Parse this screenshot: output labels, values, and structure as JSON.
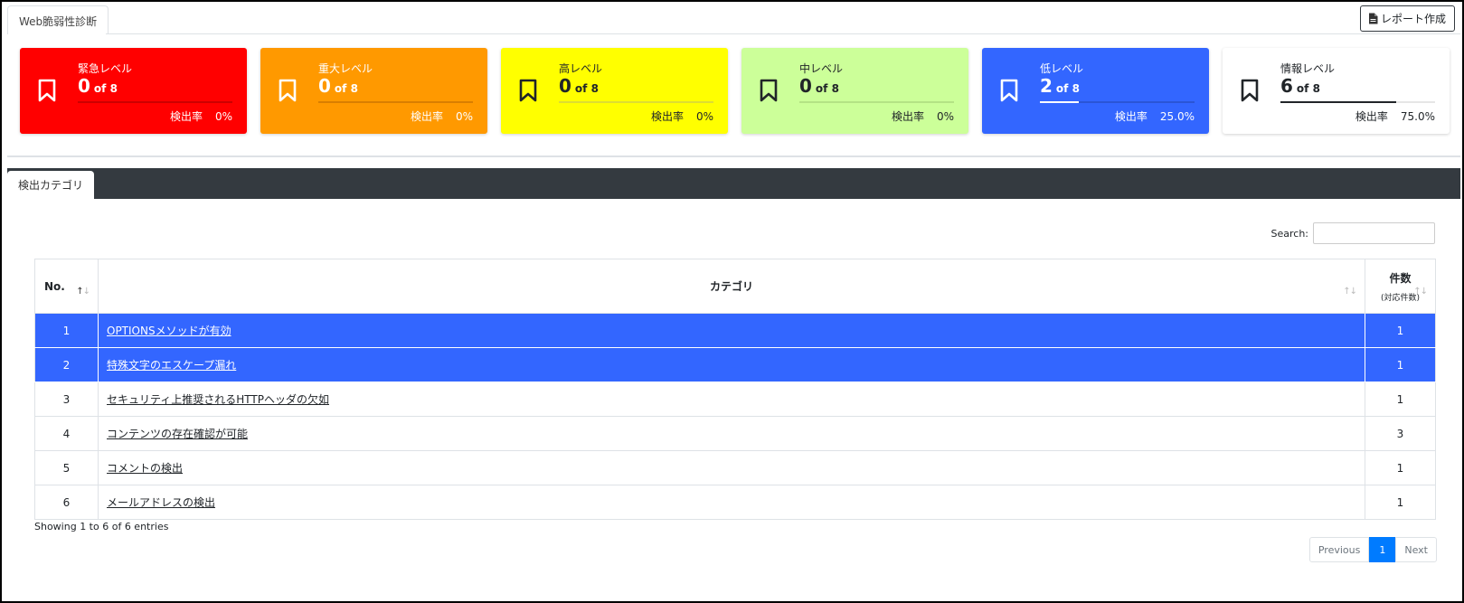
{
  "header": {
    "tab_label": "Web脆弱性診断",
    "report_button": "レポート作成"
  },
  "cards": [
    {
      "title": "緊急レベル",
      "count": "0",
      "of": "of 8",
      "rate_label": "検出率",
      "rate_value": "0%",
      "ratio": 0.0,
      "bg": "#ff0000",
      "fg": "#ffffff",
      "track": "#cc0000",
      "fill": "#ffffff"
    },
    {
      "title": "重大レベル",
      "count": "0",
      "of": "of 8",
      "rate_label": "検出率",
      "rate_value": "0%",
      "ratio": 0.0,
      "bg": "#ff9900",
      "fg": "#ffffff",
      "track": "#d97e00",
      "fill": "#ffffff"
    },
    {
      "title": "高レベル",
      "count": "0",
      "of": "of 8",
      "rate_label": "検出率",
      "rate_value": "0%",
      "ratio": 0.0,
      "bg": "#ffff00",
      "fg": "#212529",
      "track": "#dddd33",
      "fill": "#212529"
    },
    {
      "title": "中レベル",
      "count": "0",
      "of": "of 8",
      "rate_label": "検出率",
      "rate_value": "0%",
      "ratio": 0.0,
      "bg": "#ccff99",
      "fg": "#212529",
      "track": "#b4e385",
      "fill": "#212529"
    },
    {
      "title": "低レベル",
      "count": "2",
      "of": "of 8",
      "rate_label": "検出率",
      "rate_value": "25.0%",
      "ratio": 0.25,
      "bg": "#3366ff",
      "fg": "#ffffff",
      "track": "#2a55d6",
      "fill": "#ffffff"
    },
    {
      "title": "情報レベル",
      "count": "6",
      "of": "of 8",
      "rate_label": "検出率",
      "rate_value": "75.0%",
      "ratio": 0.75,
      "bg": "#ffffff",
      "fg": "#212529",
      "track": "#e6e6e6",
      "fill": "#212529"
    }
  ],
  "category_tab": "検出カテゴリ",
  "search": {
    "label": "Search:",
    "value": ""
  },
  "table": {
    "headers": {
      "no": "No.",
      "category": "カテゴリ",
      "count": "件数",
      "count_sub": "(対応件数)"
    },
    "rows": [
      {
        "no": "1",
        "category": "OPTIONSメソッドが有効",
        "count": "1",
        "selected": true
      },
      {
        "no": "2",
        "category": "特殊文字のエスケープ漏れ",
        "count": "1",
        "selected": true
      },
      {
        "no": "3",
        "category": "セキュリティ上推奨されるHTTPヘッダの欠如",
        "count": "1",
        "selected": false
      },
      {
        "no": "4",
        "category": "コンテンツの存在確認が可能",
        "count": "3",
        "selected": false
      },
      {
        "no": "5",
        "category": "コメントの検出",
        "count": "1",
        "selected": false
      },
      {
        "no": "6",
        "category": "メールアドレスの検出",
        "count": "1",
        "selected": false
      }
    ]
  },
  "info": "Showing 1 to 6 of 6 entries",
  "pagination": {
    "previous": "Previous",
    "current": "1",
    "next": "Next"
  }
}
